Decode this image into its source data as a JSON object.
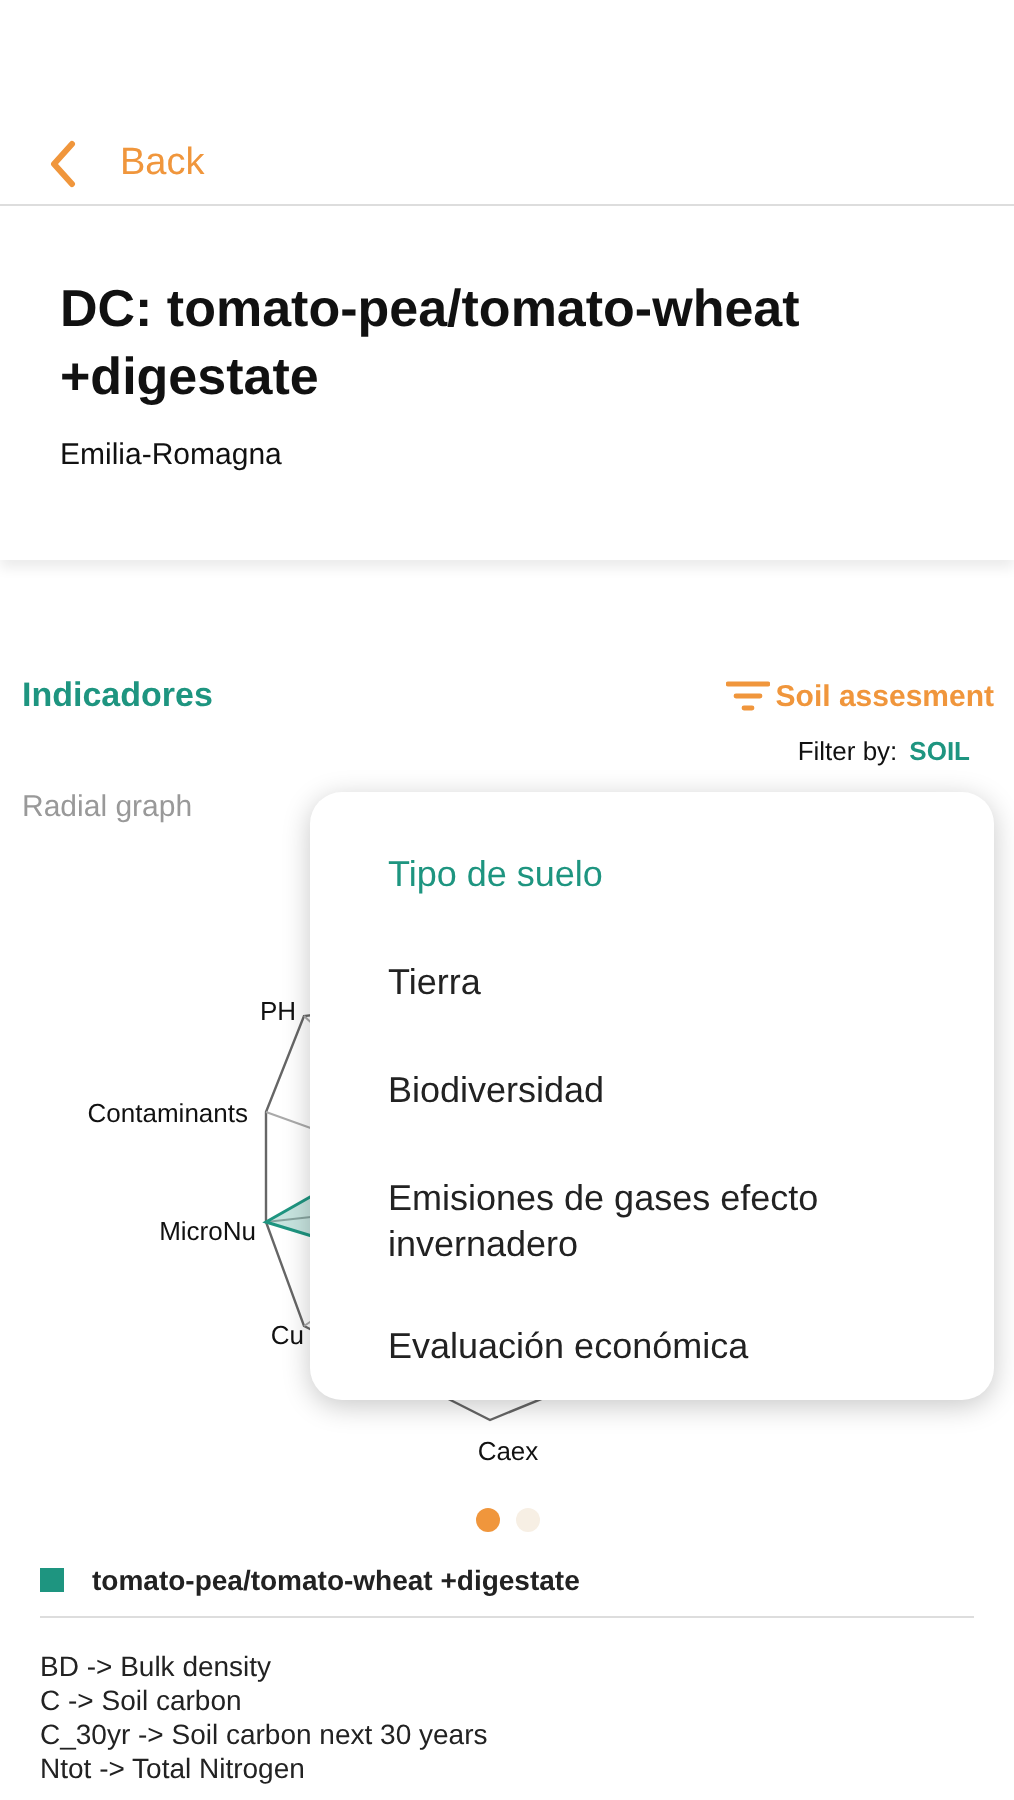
{
  "nav": {
    "back_label": "Back"
  },
  "header": {
    "title": "DC: tomato-pea/tomato-wheat +digestate",
    "region": "Emilia-Romagna"
  },
  "section": {
    "title": "Indicadores",
    "filter_button": "Soil assesment",
    "filter_by": {
      "label": "Filter by:",
      "value": "SOIL"
    }
  },
  "chart": {
    "title": "Radial graph",
    "axis_labels": [
      "PH",
      "Contaminants",
      "MicroNu",
      "Cu",
      "Caex"
    ]
  },
  "pager": [
    {
      "selected": true
    },
    {
      "selected": false
    }
  ],
  "legend": {
    "label": "tomato-pea/tomato-wheat +digestate",
    "color": "#1e9580"
  },
  "notes": [
    "BD -> Bulk density",
    "C -> Soil carbon",
    "C_30yr -> Soil carbon next 30 years",
    "Ntot -> Total Nitrogen"
  ],
  "menu": {
    "items": [
      {
        "label": "Tipo de suelo",
        "selected": true
      },
      {
        "label": "Tierra",
        "selected": false
      },
      {
        "label": "Biodiversidad",
        "selected": false
      },
      {
        "label": "Emisiones de gases efecto invernadero",
        "selected": false
      },
      {
        "label": "Evaluación económica",
        "selected": false
      }
    ]
  }
}
